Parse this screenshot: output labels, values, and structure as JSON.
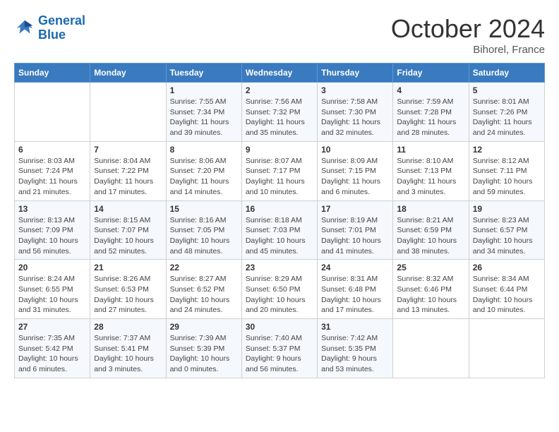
{
  "header": {
    "logo_line1": "General",
    "logo_line2": "Blue",
    "month": "October 2024",
    "location": "Bihorel, France"
  },
  "weekdays": [
    "Sunday",
    "Monday",
    "Tuesday",
    "Wednesday",
    "Thursday",
    "Friday",
    "Saturday"
  ],
  "weeks": [
    [
      {
        "day": "",
        "info": ""
      },
      {
        "day": "",
        "info": ""
      },
      {
        "day": "1",
        "info": "Sunrise: 7:55 AM\nSunset: 7:34 PM\nDaylight: 11 hours and 39 minutes."
      },
      {
        "day": "2",
        "info": "Sunrise: 7:56 AM\nSunset: 7:32 PM\nDaylight: 11 hours and 35 minutes."
      },
      {
        "day": "3",
        "info": "Sunrise: 7:58 AM\nSunset: 7:30 PM\nDaylight: 11 hours and 32 minutes."
      },
      {
        "day": "4",
        "info": "Sunrise: 7:59 AM\nSunset: 7:28 PM\nDaylight: 11 hours and 28 minutes."
      },
      {
        "day": "5",
        "info": "Sunrise: 8:01 AM\nSunset: 7:26 PM\nDaylight: 11 hours and 24 minutes."
      }
    ],
    [
      {
        "day": "6",
        "info": "Sunrise: 8:03 AM\nSunset: 7:24 PM\nDaylight: 11 hours and 21 minutes."
      },
      {
        "day": "7",
        "info": "Sunrise: 8:04 AM\nSunset: 7:22 PM\nDaylight: 11 hours and 17 minutes."
      },
      {
        "day": "8",
        "info": "Sunrise: 8:06 AM\nSunset: 7:20 PM\nDaylight: 11 hours and 14 minutes."
      },
      {
        "day": "9",
        "info": "Sunrise: 8:07 AM\nSunset: 7:17 PM\nDaylight: 11 hours and 10 minutes."
      },
      {
        "day": "10",
        "info": "Sunrise: 8:09 AM\nSunset: 7:15 PM\nDaylight: 11 hours and 6 minutes."
      },
      {
        "day": "11",
        "info": "Sunrise: 8:10 AM\nSunset: 7:13 PM\nDaylight: 11 hours and 3 minutes."
      },
      {
        "day": "12",
        "info": "Sunrise: 8:12 AM\nSunset: 7:11 PM\nDaylight: 10 hours and 59 minutes."
      }
    ],
    [
      {
        "day": "13",
        "info": "Sunrise: 8:13 AM\nSunset: 7:09 PM\nDaylight: 10 hours and 56 minutes."
      },
      {
        "day": "14",
        "info": "Sunrise: 8:15 AM\nSunset: 7:07 PM\nDaylight: 10 hours and 52 minutes."
      },
      {
        "day": "15",
        "info": "Sunrise: 8:16 AM\nSunset: 7:05 PM\nDaylight: 10 hours and 48 minutes."
      },
      {
        "day": "16",
        "info": "Sunrise: 8:18 AM\nSunset: 7:03 PM\nDaylight: 10 hours and 45 minutes."
      },
      {
        "day": "17",
        "info": "Sunrise: 8:19 AM\nSunset: 7:01 PM\nDaylight: 10 hours and 41 minutes."
      },
      {
        "day": "18",
        "info": "Sunrise: 8:21 AM\nSunset: 6:59 PM\nDaylight: 10 hours and 38 minutes."
      },
      {
        "day": "19",
        "info": "Sunrise: 8:23 AM\nSunset: 6:57 PM\nDaylight: 10 hours and 34 minutes."
      }
    ],
    [
      {
        "day": "20",
        "info": "Sunrise: 8:24 AM\nSunset: 6:55 PM\nDaylight: 10 hours and 31 minutes."
      },
      {
        "day": "21",
        "info": "Sunrise: 8:26 AM\nSunset: 6:53 PM\nDaylight: 10 hours and 27 minutes."
      },
      {
        "day": "22",
        "info": "Sunrise: 8:27 AM\nSunset: 6:52 PM\nDaylight: 10 hours and 24 minutes."
      },
      {
        "day": "23",
        "info": "Sunrise: 8:29 AM\nSunset: 6:50 PM\nDaylight: 10 hours and 20 minutes."
      },
      {
        "day": "24",
        "info": "Sunrise: 8:31 AM\nSunset: 6:48 PM\nDaylight: 10 hours and 17 minutes."
      },
      {
        "day": "25",
        "info": "Sunrise: 8:32 AM\nSunset: 6:46 PM\nDaylight: 10 hours and 13 minutes."
      },
      {
        "day": "26",
        "info": "Sunrise: 8:34 AM\nSunset: 6:44 PM\nDaylight: 10 hours and 10 minutes."
      }
    ],
    [
      {
        "day": "27",
        "info": "Sunrise: 7:35 AM\nSunset: 5:42 PM\nDaylight: 10 hours and 6 minutes."
      },
      {
        "day": "28",
        "info": "Sunrise: 7:37 AM\nSunset: 5:41 PM\nDaylight: 10 hours and 3 minutes."
      },
      {
        "day": "29",
        "info": "Sunrise: 7:39 AM\nSunset: 5:39 PM\nDaylight: 10 hours and 0 minutes."
      },
      {
        "day": "30",
        "info": "Sunrise: 7:40 AM\nSunset: 5:37 PM\nDaylight: 9 hours and 56 minutes."
      },
      {
        "day": "31",
        "info": "Sunrise: 7:42 AM\nSunset: 5:35 PM\nDaylight: 9 hours and 53 minutes."
      },
      {
        "day": "",
        "info": ""
      },
      {
        "day": "",
        "info": ""
      }
    ]
  ]
}
